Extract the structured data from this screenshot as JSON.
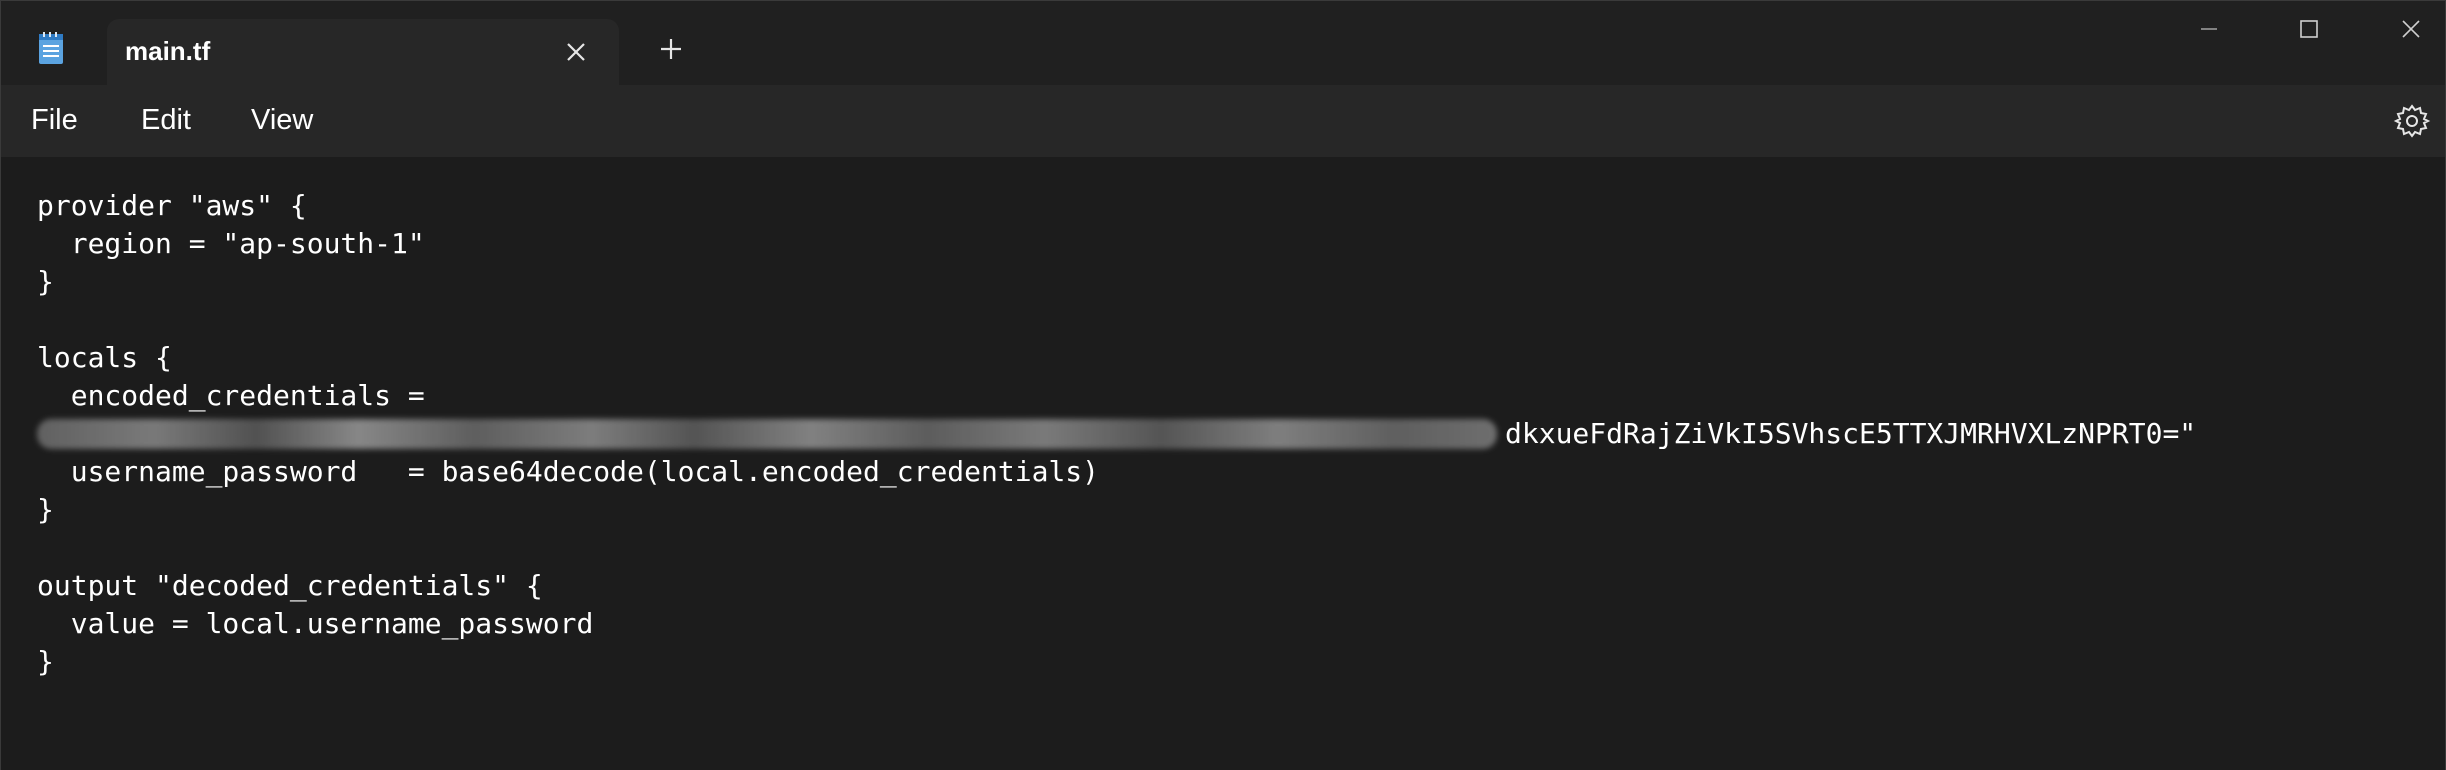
{
  "tab": {
    "title": "main.tf",
    "icon": "notepad-icon"
  },
  "menu": {
    "file": "File",
    "edit": "Edit",
    "view": "View"
  },
  "editor": {
    "lines": [
      "provider \"aws\" {",
      "  region = \"ap-south-1\"",
      "}",
      "",
      "locals {",
      "  encoded_credentials =",
      "dkxueFdRajZiVkI5SVhscE5TTXJMRHVXLzNPRT0=\"",
      "  username_password   = base64decode(local.encoded_credentials)",
      "}",
      "",
      "output \"decoded_credentials\" {",
      "  value = local.username_password",
      "}"
    ]
  },
  "colors": {
    "titlebar": "#202020",
    "menubar": "#272727",
    "editor_bg": "#1c1c1c",
    "text": "#ffffff"
  }
}
